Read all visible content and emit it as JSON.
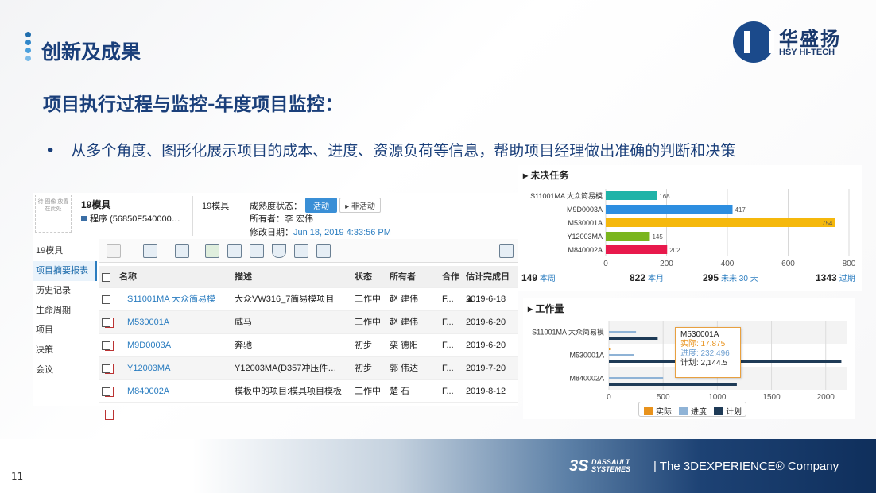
{
  "header": {
    "section_title": "创新及成果",
    "subtitle": "项目执行过程与监控-年度项目监控：",
    "bullet_marker": "•",
    "bullet_text": "从多个角度、图形化展示项目的成本、进度、资源负荷等信息，帮助项目经理做出准确的判断和决策"
  },
  "logo": {
    "cn": "华盛扬",
    "en": "HSY HI-TECH"
  },
  "app": {
    "thumb_text": "待 图像 放置 在此处",
    "name": "19模具",
    "program": "程序 (56850F540000…",
    "tag": "19模具",
    "maturity_label": "成熟度状态：",
    "active_btn": "活动",
    "inactive_btn": "▸ 非活动",
    "owner": "所有者：李 宏伟",
    "modified_label": "修改日期：",
    "modified_value": "Jun 18, 2019 4:33:56 PM",
    "sidebar": [
      "19模具",
      "项目摘要报表",
      "历史记录",
      "生命周期",
      "项目",
      "决策",
      "会议"
    ],
    "columns": [
      "名称",
      "描述",
      "状态",
      "所有者",
      "合作",
      "估计完成日▲"
    ],
    "rows": [
      {
        "name": "S11001MA 大众简易模",
        "desc": "大众VW316_7简易模项目",
        "status": "工作中",
        "owner": "赵 建伟",
        "coop": "F...",
        "date": "2019-6-18"
      },
      {
        "name": "M530001A",
        "desc": "威马",
        "status": "工作中",
        "owner": "赵 建伟",
        "coop": "F...",
        "date": "2019-6-20"
      },
      {
        "name": "M9D0003A",
        "desc": "奔驰",
        "status": "初步",
        "owner": "栾 德阳",
        "coop": "F...",
        "date": "2019-6-20"
      },
      {
        "name": "Y12003MA",
        "desc": "Y12003MA(D357冲压件…",
        "status": "初步",
        "owner": "郭 伟达",
        "coop": "F...",
        "date": "2019-7-20"
      },
      {
        "name": "M840002A",
        "desc": "模板中的项目:模具项目模板",
        "status": "工作中",
        "owner": "楚 石",
        "coop": "F...",
        "date": "2019-8-12"
      }
    ]
  },
  "stats": [
    {
      "value": "149",
      "label": "本周"
    },
    {
      "value": "822",
      "label": "本月"
    },
    {
      "value": "295",
      "label": "未来 30 天"
    },
    {
      "value": "1343",
      "label": "过期"
    }
  ],
  "tooltip": {
    "title": "M530001A",
    "actual": "实际: 17.875",
    "progress": "进度: 232.496",
    "plan": "计划: 2,144.5"
  },
  "legend": [
    "实际",
    "进度",
    "计划"
  ],
  "page_number": "11",
  "footer": {
    "brand": "DASSAULT SYSTEMES",
    "tagline": "| The 3DEXPERIENCE® Company"
  },
  "chart_data": [
    {
      "type": "bar",
      "title": "未决任务",
      "orientation": "horizontal",
      "categories": [
        "S11001MA 大众简易模",
        "M9D0003A",
        "M530001A",
        "Y12003MA",
        "M840002A"
      ],
      "values": [
        168,
        417,
        754,
        145,
        202
      ],
      "colors": [
        "#1fb3a8",
        "#2d8ee0",
        "#f5b80c",
        "#7ab51d",
        "#e8194c"
      ],
      "xlim": [
        0,
        800
      ],
      "xticks": [
        0,
        200,
        400,
        600,
        800
      ],
      "grid": true
    },
    {
      "type": "bar",
      "title": "工作量",
      "orientation": "horizontal",
      "categories": [
        "S11001MA 大众简易模",
        "M530001A",
        "M840002A"
      ],
      "series": [
        {
          "name": "实际",
          "color": "#e8921c",
          "values": [
            0,
            17.875,
            0
          ]
        },
        {
          "name": "进度",
          "color": "#8fb3d6",
          "values": [
            250,
            232.496,
            500
          ]
        },
        {
          "name": "计划",
          "color": "#1e3a56",
          "values": [
            450,
            2144.5,
            1180
          ]
        }
      ],
      "xlim": [
        0,
        2200
      ],
      "xticks": [
        0,
        500,
        1000,
        1500,
        2000
      ],
      "legend": "bottom",
      "grid": true
    }
  ]
}
